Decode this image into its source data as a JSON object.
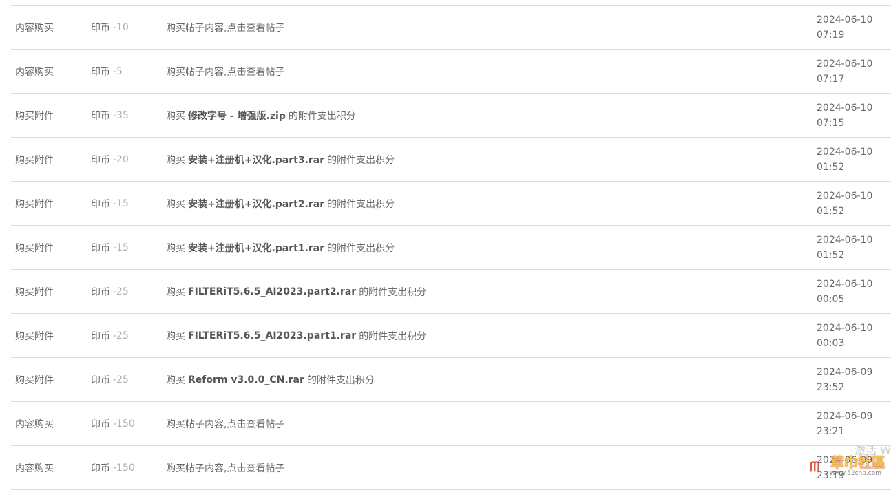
{
  "rows": [
    {
      "type": "内容购买",
      "currency": "印币",
      "amount": "-10",
      "desc_prefix": "购买帖子内容,点击查看帖子",
      "file": "",
      "desc_suffix": "",
      "date": "2024-06-10",
      "time": "07:19"
    },
    {
      "type": "内容购买",
      "currency": "印币",
      "amount": "-5",
      "desc_prefix": "购买帖子内容,点击查看帖子",
      "file": "",
      "desc_suffix": "",
      "date": "2024-06-10",
      "time": "07:17"
    },
    {
      "type": "购买附件",
      "currency": "印币",
      "amount": "-35",
      "desc_prefix": "购买",
      "file": "修改字号 - 增强版.zip",
      "desc_suffix": "的附件支出积分",
      "date": "2024-06-10",
      "time": "07:15"
    },
    {
      "type": "购买附件",
      "currency": "印币",
      "amount": "-20",
      "desc_prefix": "购买",
      "file": "安装+注册机+汉化.part3.rar",
      "desc_suffix": "的附件支出积分",
      "date": "2024-06-10",
      "time": "01:52"
    },
    {
      "type": "购买附件",
      "currency": "印币",
      "amount": "-15",
      "desc_prefix": "购买",
      "file": "安装+注册机+汉化.part2.rar",
      "desc_suffix": "的附件支出积分",
      "date": "2024-06-10",
      "time": "01:52"
    },
    {
      "type": "购买附件",
      "currency": "印币",
      "amount": "-15",
      "desc_prefix": "购买",
      "file": "安装+注册机+汉化.part1.rar",
      "desc_suffix": "的附件支出积分",
      "date": "2024-06-10",
      "time": "01:52"
    },
    {
      "type": "购买附件",
      "currency": "印币",
      "amount": "-25",
      "desc_prefix": "购买",
      "file": "FILTERiT5.6.5_AI2023.part2.rar",
      "desc_suffix": "的附件支出积分",
      "date": "2024-06-10",
      "time": "00:05"
    },
    {
      "type": "购买附件",
      "currency": "印币",
      "amount": "-25",
      "desc_prefix": "购买",
      "file": "FILTERiT5.6.5_AI2023.part1.rar",
      "desc_suffix": "的附件支出积分",
      "date": "2024-06-10",
      "time": "00:03"
    },
    {
      "type": "购买附件",
      "currency": "印币",
      "amount": "-25",
      "desc_prefix": "购买",
      "file": "Reform v3.0.0_CN.rar",
      "desc_suffix": "的附件支出积分",
      "date": "2024-06-09",
      "time": "23:52"
    },
    {
      "type": "内容购买",
      "currency": "印币",
      "amount": "-150",
      "desc_prefix": "购买帖子内容,点击查看帖子",
      "file": "",
      "desc_suffix": "",
      "date": "2024-06-09",
      "time": "23:21"
    },
    {
      "type": "内容购买",
      "currency": "印币",
      "amount": "-150",
      "desc_prefix": "购买帖子内容,点击查看帖子",
      "file": "",
      "desc_suffix": "",
      "date": "2024-06-09",
      "time": "23:19"
    }
  ],
  "overlay": {
    "activate_text": "激活 W",
    "watermark_title": "草巾社區",
    "watermark_url": "www.52cnp.com"
  }
}
